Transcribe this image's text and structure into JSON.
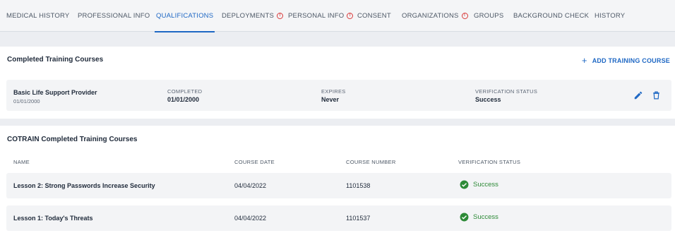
{
  "tabs": [
    {
      "label": "MEDICAL HISTORY",
      "alert": false
    },
    {
      "label": "PROFESSIONAL INFO",
      "alert": false
    },
    {
      "label": "QUALIFICATIONS",
      "alert": false,
      "active": true
    },
    {
      "label": "DEPLOYMENTS",
      "alert": true
    },
    {
      "label": "PERSONAL INFO",
      "alert": true
    },
    {
      "label": "CONSENT",
      "alert": false
    },
    {
      "label": "ORGANIZATIONS",
      "alert": true
    },
    {
      "label": "GROUPS",
      "alert": false
    },
    {
      "label": "BACKGROUND CHECK",
      "alert": false
    },
    {
      "label": "HISTORY",
      "alert": false
    }
  ],
  "training": {
    "title": "Completed Training Courses",
    "add_label": "ADD TRAINING COURSE",
    "course": {
      "name": "Basic Life Support Provider",
      "date": "01/01/2000",
      "completed_label": "COMPLETED",
      "completed_value": "01/01/2000",
      "expires_label": "EXPIRES",
      "expires_value": "Never",
      "verification_label": "VERIFICATION STATUS",
      "verification_value": "Success"
    }
  },
  "cotrain": {
    "title": "COTRAIN Completed Training Courses",
    "columns": [
      "NAME",
      "COURSE DATE",
      "COURSE NUMBER",
      "VERIFICATION STATUS"
    ],
    "rows": [
      {
        "name": "Lesson 2: Strong Passwords Increase Security",
        "date": "04/04/2022",
        "number": "1101538",
        "status": "Success"
      },
      {
        "name": "Lesson 1: Today's Threats",
        "date": "04/04/2022",
        "number": "1101537",
        "status": "Success"
      }
    ]
  },
  "colors": {
    "accent": "#1f68c4",
    "alert": "#d93a3a",
    "success": "#2d8a37"
  }
}
